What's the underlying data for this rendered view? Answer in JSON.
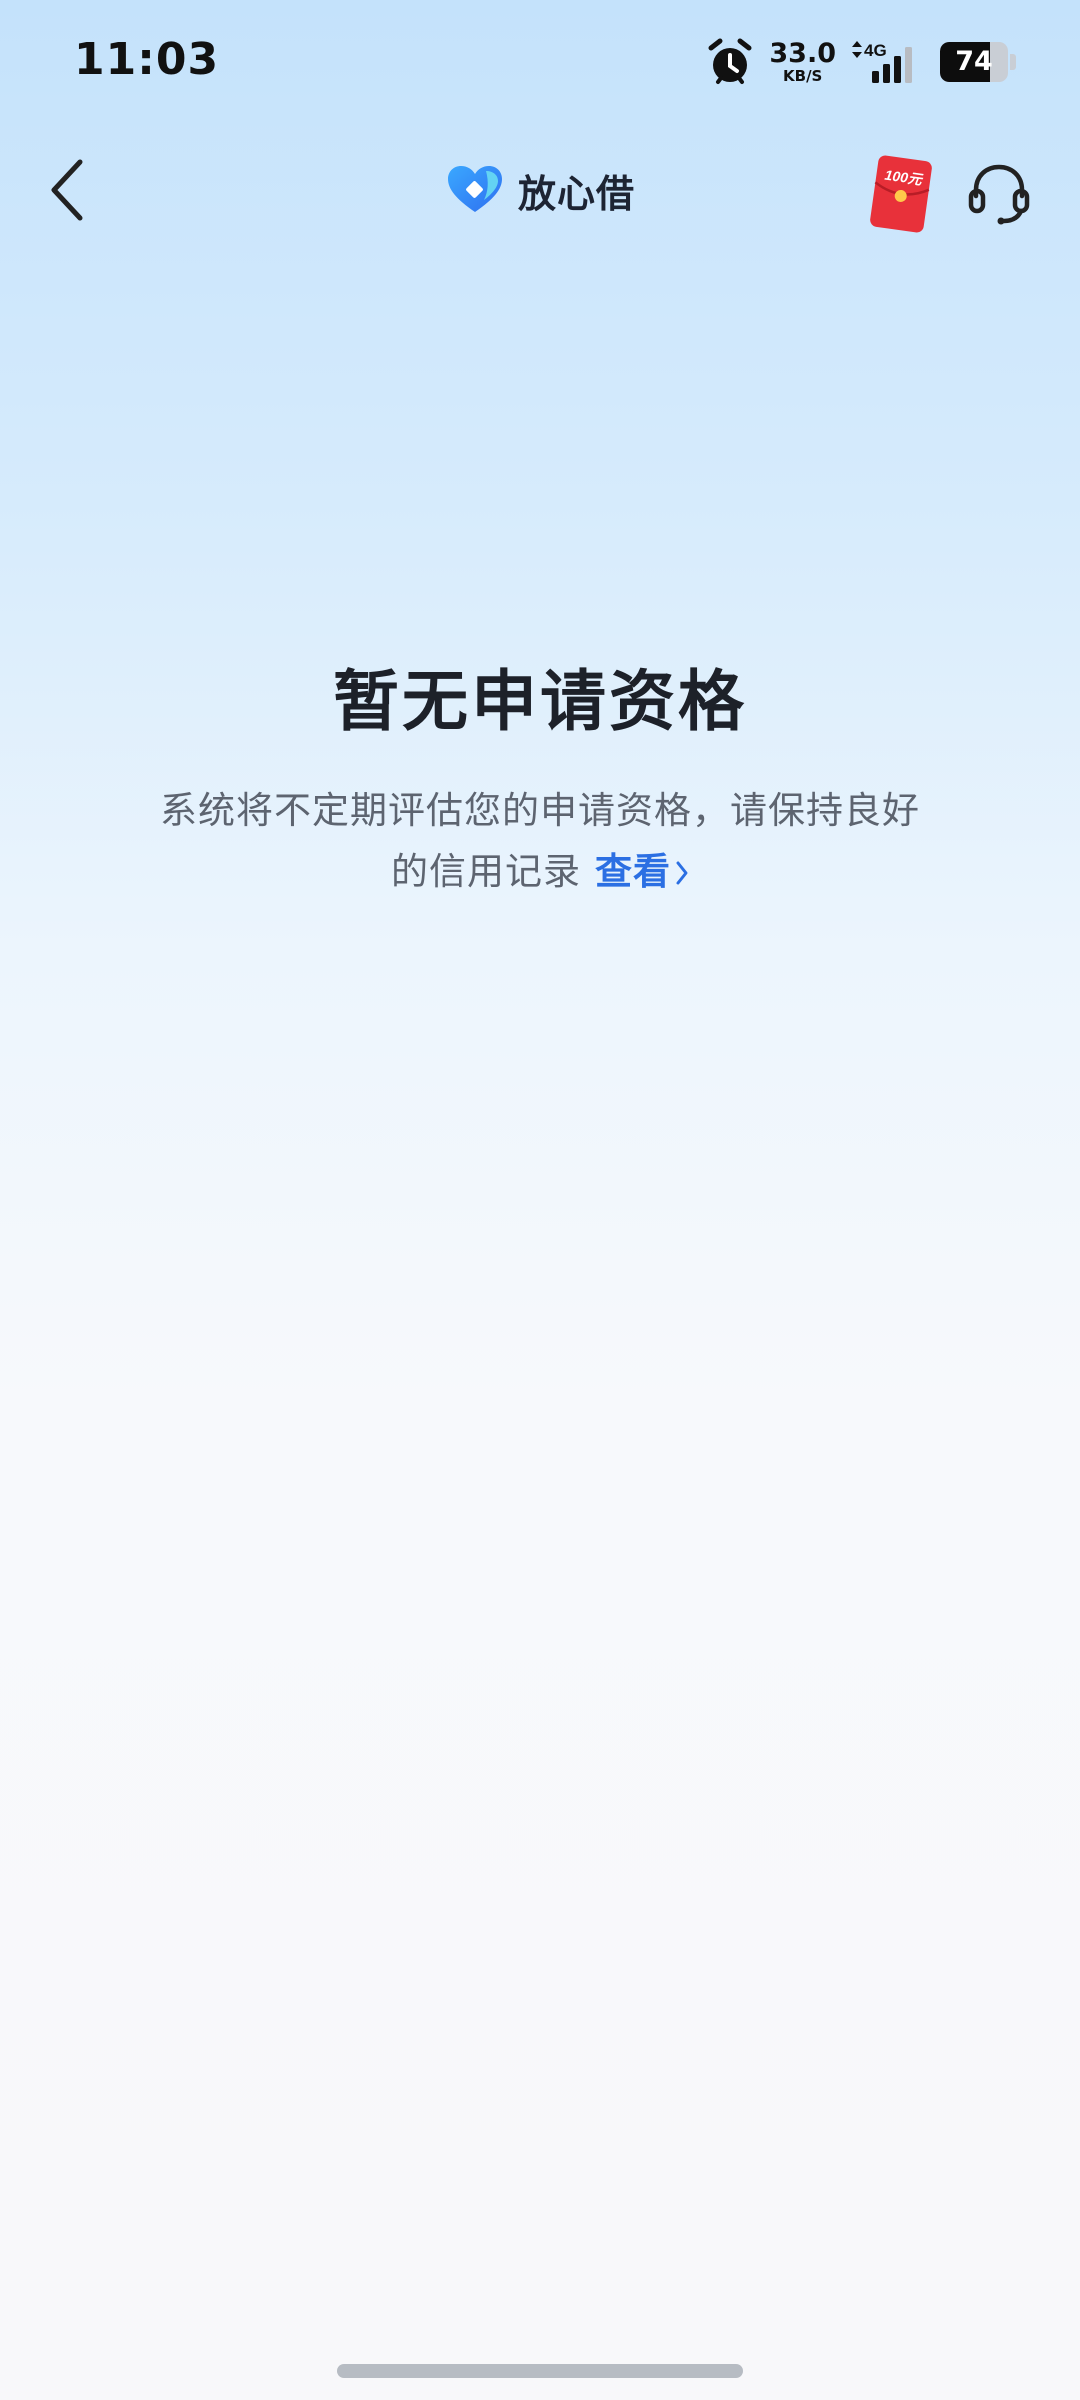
{
  "status_bar": {
    "time": "11:03",
    "net_speed_value": "33.0",
    "net_speed_unit": "KB/S",
    "network_type": "4G",
    "battery_level": "74",
    "battery_fraction": 0.74
  },
  "header": {
    "brand_name": "放心借",
    "red_packet_label": "100元"
  },
  "main": {
    "title": "暂无申请资格",
    "description": "系统将不定期评估您的申请资格，请保持良好的信用记录",
    "link_label": "查看"
  },
  "colors": {
    "link": "#2b6fe3",
    "title": "#1d2129",
    "description": "#5d6470",
    "red_packet": "#e8313a"
  },
  "icons": {
    "back": "chevron-left-icon",
    "brand": "heart-logo-icon",
    "red_packet": "red-packet-icon",
    "support": "headset-icon",
    "alarm": "alarm-clock-icon",
    "signal": "signal-icon"
  }
}
